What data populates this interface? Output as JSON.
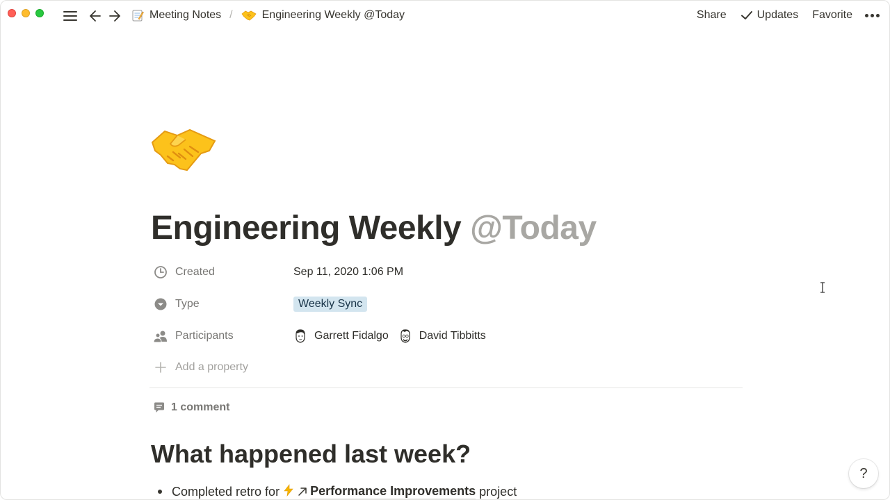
{
  "breadcrumb": {
    "items": [
      {
        "icon": "memo-icon",
        "label": "Meeting Notes"
      },
      {
        "icon": "handshake-icon",
        "label": "Engineering Weekly @Today"
      }
    ],
    "separator": "/"
  },
  "topbar": {
    "share_label": "Share",
    "updates_label": "Updates",
    "favorite_label": "Favorite"
  },
  "page": {
    "icon": "handshake-icon",
    "title": "Engineering Weekly",
    "title_mention": "@Today"
  },
  "properties": {
    "created": {
      "label": "Created",
      "value": "Sep 11, 2020 1:06 PM",
      "icon": "clock-icon"
    },
    "type": {
      "label": "Type",
      "value": "Weekly Sync",
      "icon": "select-icon",
      "tag_color": "#d3e5ef"
    },
    "participants": {
      "label": "Participants",
      "icon": "people-icon",
      "people": [
        {
          "name": "Garrett Fidalgo"
        },
        {
          "name": "David Tibbitts"
        }
      ]
    },
    "add_label": "Add a property"
  },
  "comments": {
    "label": "1 comment"
  },
  "content": {
    "heading": "What happened last week?",
    "bullets": [
      {
        "before": "Completed retro for",
        "link": "Performance Improvements",
        "after": "project"
      }
    ]
  },
  "help": {
    "label": "?"
  }
}
